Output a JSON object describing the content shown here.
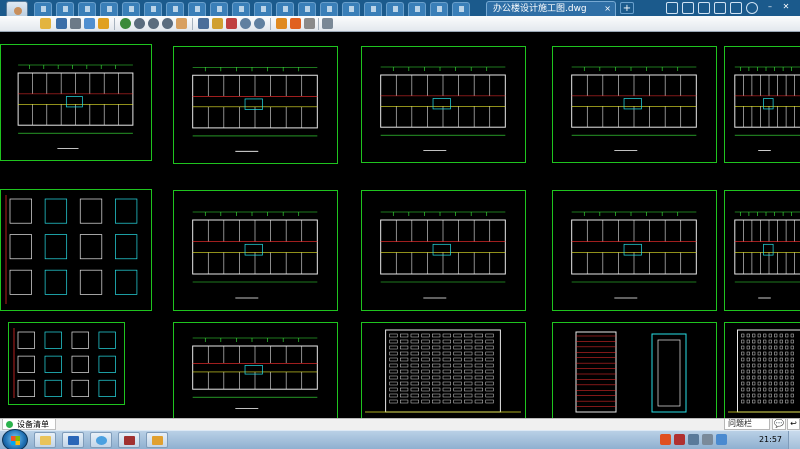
{
  "window": {
    "active_tab_title": "办公楼设计施工图.dwg",
    "active_tab_close": "×",
    "add_tab_label": "+",
    "tray_icons": [
      "user-icon",
      "history-icon",
      "chat-icon",
      "phone-icon",
      "cloud-icon",
      "settings-icon"
    ]
  },
  "toolbar": {
    "icons": [
      "open-icon",
      "save-icon",
      "print-icon",
      "export-icon",
      "lock-icon",
      "rotate-icon",
      "zoom-window-icon",
      "zoom-in-icon",
      "zoom-out-icon",
      "pan-icon",
      "text-icon",
      "pen-icon",
      "color-icon",
      "undo-icon",
      "redo-icon",
      "layer-icon",
      "hatch-icon",
      "measure-icon",
      "stack-icon",
      "exit-icon"
    ]
  },
  "canvas": {
    "background": "#000000",
    "sheet_color": "#1fc41f"
  },
  "statusbar": {
    "tab_label": "设备清单"
  },
  "help": {
    "label": "问题栏",
    "icon2": "💬",
    "icon3": "↩"
  },
  "taskbar": {
    "clock": "21:57",
    "apps": [
      "explorer-icon",
      "media-player-icon",
      "app-window-icon",
      "library-icon",
      "cad-viewer-icon"
    ]
  }
}
